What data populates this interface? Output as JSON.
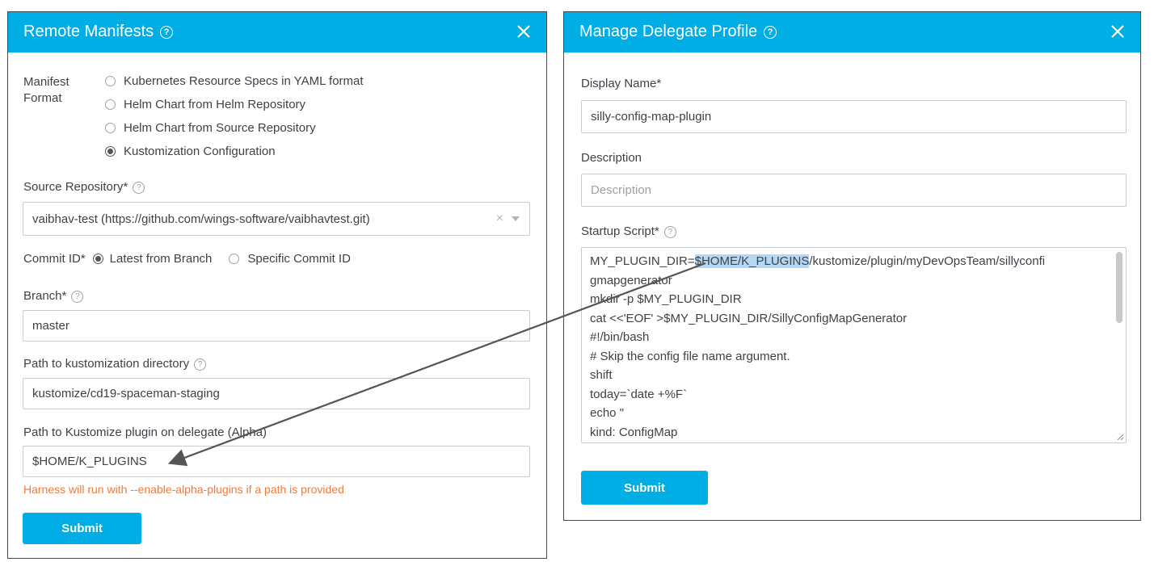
{
  "remote_manifests": {
    "title": "Remote Manifests",
    "help_icon": "question-circle-icon",
    "close_icon": "close-icon",
    "manifest_format_label_line1": "Manifest",
    "manifest_format_label_line2": "Format",
    "format_options": [
      {
        "label": "Kubernetes Resource Specs in YAML format",
        "selected": false
      },
      {
        "label": "Helm Chart from Helm Repository",
        "selected": false
      },
      {
        "label": "Helm Chart from Source Repository",
        "selected": false
      },
      {
        "label": "Kustomization Configuration",
        "selected": true
      }
    ],
    "source_repo_label": "Source Repository*",
    "source_repo_value": "vaibhav-test (https://github.com/wings-software/vaibhavtest.git)",
    "commit_id_label": "Commit ID*",
    "commit_options": [
      {
        "label": "Latest from Branch",
        "selected": true
      },
      {
        "label": "Specific Commit ID",
        "selected": false
      }
    ],
    "branch_label": "Branch*",
    "branch_value": "master",
    "kustomization_dir_label": "Path to kustomization directory",
    "kustomization_dir_value": "kustomize/cd19-spaceman-staging",
    "plugin_path_label": "Path to Kustomize plugin on delegate (Alpha)",
    "plugin_path_value": "$HOME/K_PLUGINS",
    "plugin_warning": "Harness will run with --enable-alpha-plugins if a path is provided",
    "submit_label": "Submit"
  },
  "delegate_profile": {
    "title": "Manage Delegate Profile",
    "display_name_label": "Display Name*",
    "display_name_value": "silly-config-map-plugin",
    "description_label": "Description",
    "description_placeholder": "Description",
    "startup_script_label": "Startup Script*",
    "script_first_prefix": "MY_PLUGIN_DIR=",
    "script_first_highlight": "$HOME/K_PLUGINS",
    "script_first_suffix": "/kustomize/plugin/myDevOpsTeam/sillyconfi",
    "script_lines": [
      "gmapgenerator",
      "mkdir -p $MY_PLUGIN_DIR",
      "cat <<'EOF' >$MY_PLUGIN_DIR/SillyConfigMapGenerator",
      "#!/bin/bash",
      "# Skip the config file name argument.",
      "shift",
      "today=`date +%F`",
      "echo \"",
      "kind: ConfigMap"
    ],
    "submit_label": "Submit"
  },
  "colors": {
    "header": "#00ade4",
    "button": "#00ade4",
    "warning": "#f07a3a",
    "highlight": "#b3d7f5"
  }
}
